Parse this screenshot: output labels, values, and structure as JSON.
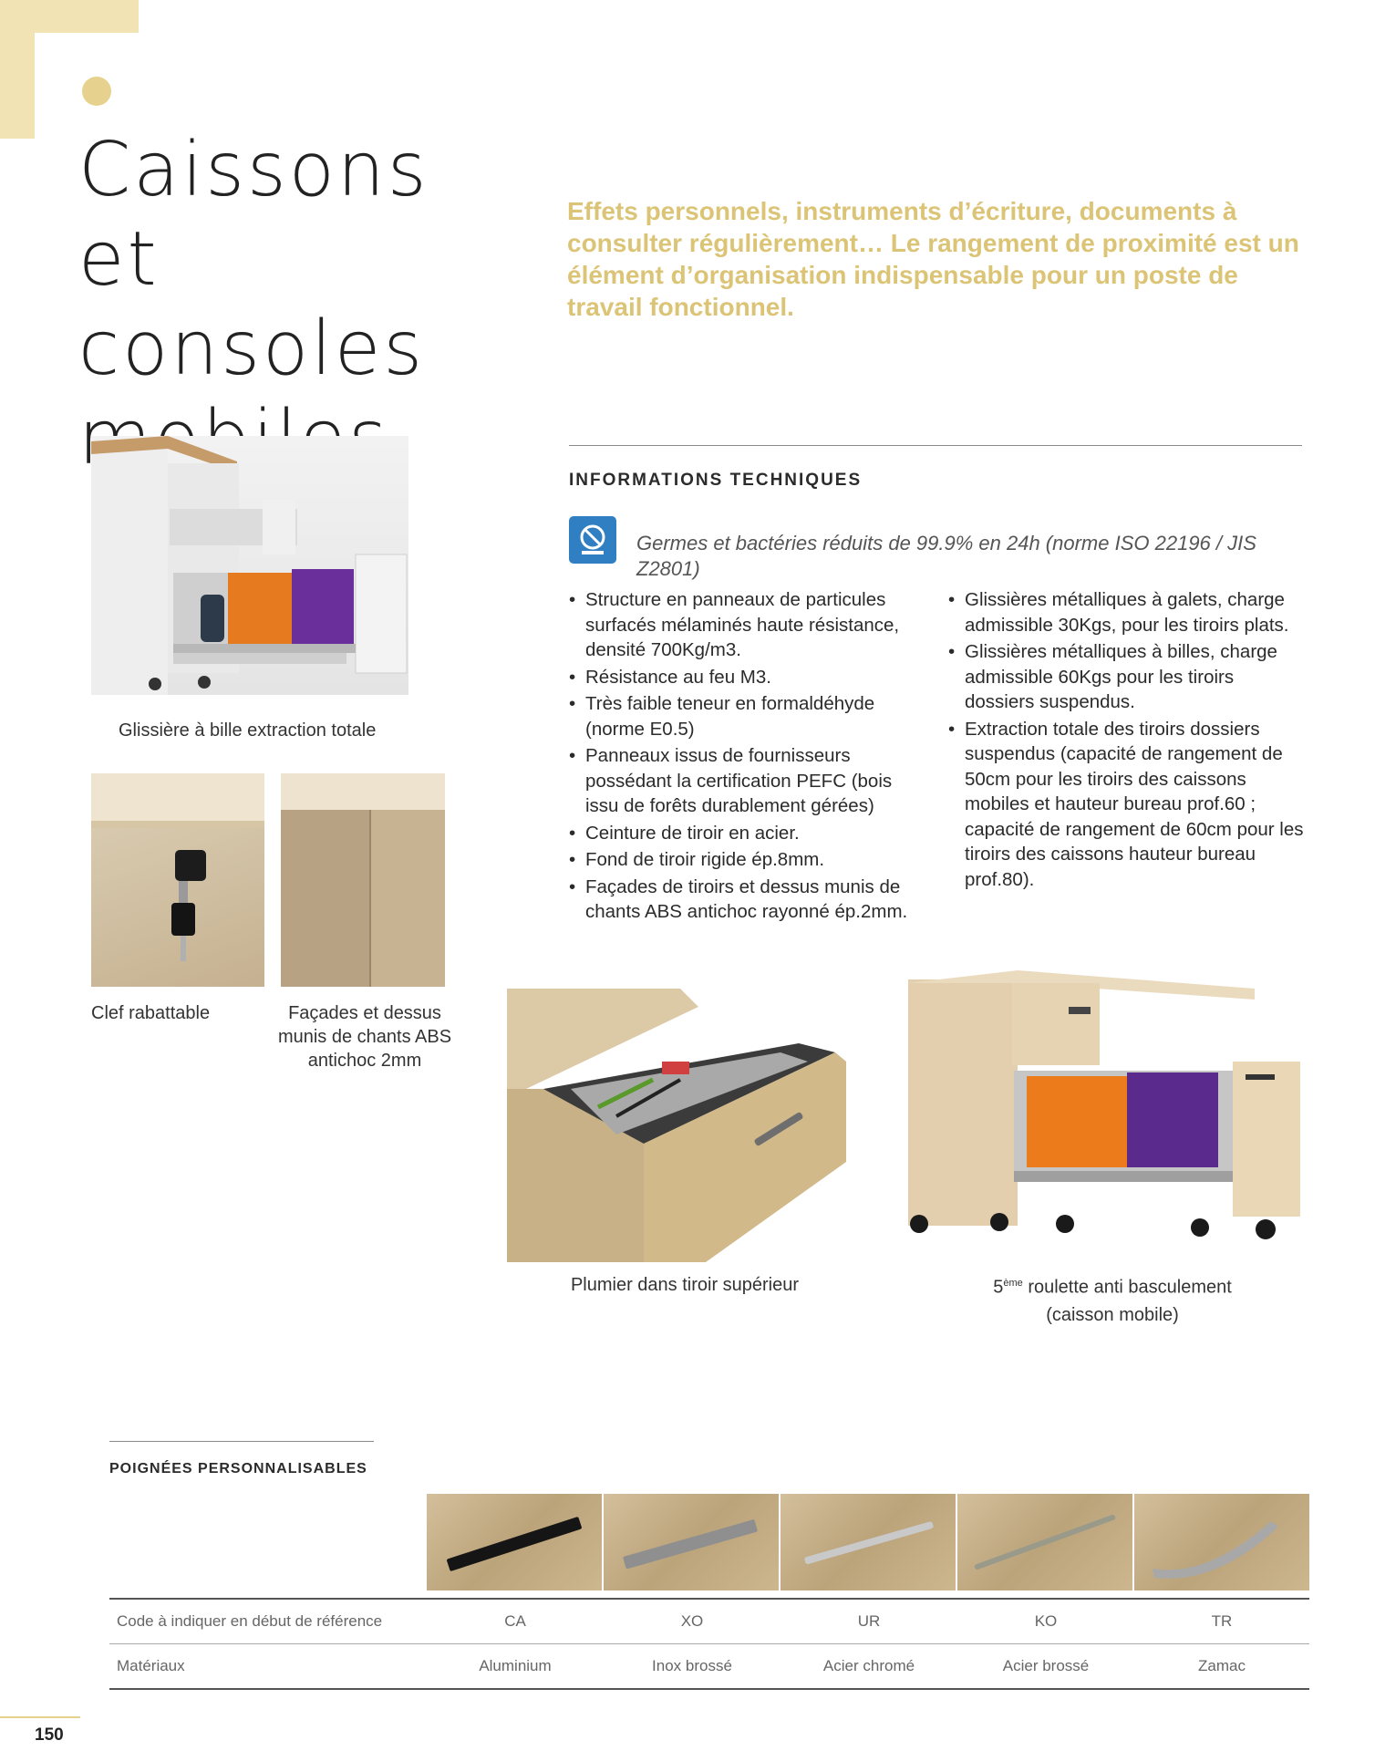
{
  "page": {
    "title": "Caissons et consoles mobiles",
    "intro": "Effets personnels, instruments d’écriture, documents à consulter régulièrement… Le rangement de proximité est un élément  d’organisation indispensable pour un poste de travail fonctionnel.",
    "page_number": "150"
  },
  "colors": {
    "accent_gold": "#dcc477",
    "corner_cream": "#f1e3b4",
    "antibac_blue": "#2f7fc2"
  },
  "photos": {
    "slide": {
      "caption": "Glissière à bille extraction totale"
    },
    "key": {
      "caption": "Clef rabattable"
    },
    "edges": {
      "caption": "Façades et dessus munis de chants ABS antichoc 2mm"
    },
    "pen_tray": {
      "caption": "Plumier dans tiroir supérieur"
    },
    "wheel": {
      "caption_sup": "ème",
      "caption_prefix": "5",
      "caption_main": "roulette anti basculement",
      "caption_sub": "(caisson mobile)"
    }
  },
  "tech": {
    "heading": "INFORMATIONS TECHNIQUES",
    "antibac_icon": "antibacterial-shield-icon",
    "antibac_text": "Germes et bactéries réduits de 99.9% en 24h (norme ISO 22196 / JIS Z2801)",
    "left_items": [
      "Structure en panneaux de particules surfacés mélaminés haute résistance, densité 700Kg/m3.",
      "Résistance au feu M3.",
      "Très faible teneur en formaldéhyde (norme E0.5)",
      "Panneaux issus de fournisseurs possédant la certification PEFC (bois issu de forêts durablement gérées)",
      "Ceinture de tiroir en acier.",
      "Fond de tiroir rigide ép.8mm.",
      "Façades de tiroirs et dessus munis de chants ABS antichoc rayonné ép.2mm."
    ],
    "right_items": [
      "Glissières métalliques à galets, charge admissible 30Kgs, pour les tiroirs plats.",
      "Glissières métalliques à billes, charge admissible 60Kgs pour les tiroirs dossiers suspendus.",
      "Extraction totale des tiroirs dossiers suspendus (capacité de rangement de 50cm pour les tiroirs des caissons mobiles et hauteur bureau prof.60 ; capacité de rangement de 60cm pour les tiroirs des caissons hauteur bureau prof.80)."
    ]
  },
  "handles": {
    "heading": "POIGNÉES PERSONNALISABLES",
    "code_label": "Code à indiquer en début de référence",
    "material_label": "Matériaux",
    "items": [
      {
        "code": "CA",
        "material": "Aluminium",
        "icon": "handle-black-bar-icon"
      },
      {
        "code": "XO",
        "material": "Inox brossé",
        "icon": "handle-brushed-bar-icon"
      },
      {
        "code": "UR",
        "material": "Acier chromé",
        "icon": "handle-chrome-bar-icon"
      },
      {
        "code": "KO",
        "material": "Acier brossé",
        "icon": "handle-rod-icon"
      },
      {
        "code": "TR",
        "material": "Zamac",
        "icon": "handle-curved-icon"
      }
    ]
  }
}
